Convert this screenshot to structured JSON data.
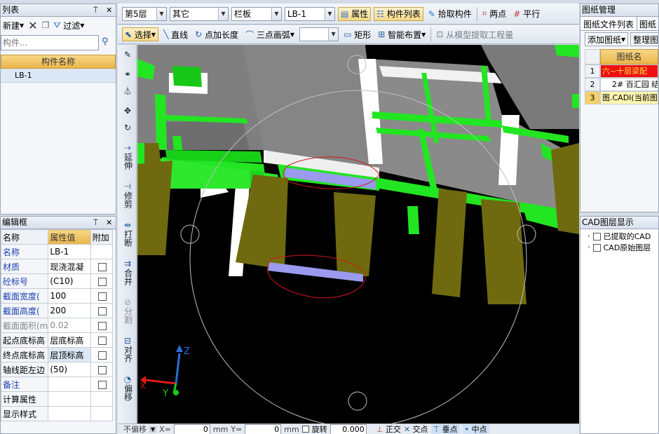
{
  "left_panel": {
    "title": "列表",
    "new_label": "新建",
    "filter_label": "过滤",
    "search_placeholder": "构件...",
    "column_header": "构件名称",
    "rows": [
      {
        "index": "1",
        "name": "LB-1"
      }
    ]
  },
  "prop_panel": {
    "title": "编辑框",
    "headers": {
      "name": "名称",
      "value": "属性值",
      "extra": "附加"
    },
    "rows": [
      {
        "name": "名称",
        "value": "LB-1",
        "checkbox": false,
        "blue": true
      },
      {
        "name": "材质",
        "value": "现浇混凝",
        "checkbox": true,
        "blue": true
      },
      {
        "name": "砼标号",
        "value": "(C10)",
        "checkbox": true,
        "blue": true
      },
      {
        "name": "截面宽度(",
        "value": "100",
        "checkbox": true,
        "blue": true
      },
      {
        "name": "截面高度(",
        "value": "200",
        "checkbox": true,
        "blue": true
      },
      {
        "name": "截面面积(m",
        "value": "0.02",
        "checkbox": true,
        "blue": false,
        "gray": true
      },
      {
        "name": "起点底标高",
        "value": "层底标高",
        "checkbox": true,
        "blue": false
      },
      {
        "name": "终点底标高",
        "value": "层顶标高",
        "checkbox": true,
        "blue": false
      },
      {
        "name": "轴线距左边",
        "value": "(50)",
        "checkbox": true,
        "blue": false
      },
      {
        "name": "备注",
        "value": "",
        "checkbox": true,
        "blue": true
      },
      {
        "name": "计算属性",
        "value": "",
        "checkbox": false,
        "blue": false,
        "expand": true
      },
      {
        "name": "显示样式",
        "value": "",
        "checkbox": false,
        "blue": false,
        "expand": true
      }
    ]
  },
  "toolbar1": {
    "floor": "第5层",
    "category": "其它",
    "type": "栏板",
    "component": "LB-1",
    "properties": "属性",
    "component_list": "构件列表",
    "pick_component": "拾取构件",
    "two_points": "两点",
    "parallel": "平行"
  },
  "toolbar2": {
    "select": "选择",
    "line": "直线",
    "point_length": "点加长度",
    "three_point_arc": "三点画弧",
    "rectangle": "矩形",
    "smart_layout": "智能布置",
    "extract_model": "从模型提取工程量"
  },
  "vertical_tools": [
    {
      "icon": "extend-icon",
      "label": "延伸"
    },
    {
      "icon": "trim-icon",
      "label": "修剪"
    },
    {
      "icon": "break-icon",
      "label": "打断"
    },
    {
      "icon": "merge-icon",
      "label": "合并"
    },
    {
      "icon": "split-icon",
      "label": "分割"
    },
    {
      "icon": "align-icon",
      "label": "对齐"
    },
    {
      "icon": "offset-icon",
      "label": "偏移"
    }
  ],
  "status_bar": {
    "no_offset": "不偏移",
    "x_label": "X=",
    "x_value": "0",
    "unit": "mm",
    "y_label": "Y=",
    "y_value": "0",
    "rotate_label": "旋转",
    "rotate_value": "0.000",
    "ortho": "正交",
    "intersect": "交点",
    "perpendicular": "垂点",
    "midpoint": "中点"
  },
  "drawing_panel": {
    "title": "图纸管理",
    "tab_files": "图纸文件列表",
    "tab_other": "图纸",
    "add_button": "添加图纸",
    "organize_button": "整理图",
    "column_header": "图纸名",
    "rows": [
      {
        "index": "1",
        "text": "六~十层梁配",
        "style": "red"
      },
      {
        "index": "2",
        "text": "2# 百汇园 结",
        "style": "normal"
      },
      {
        "index": "3",
        "text": "图.CADI(当前图",
        "style": "yellow"
      }
    ]
  },
  "cad_layer_panel": {
    "title": "CAD图层显示",
    "items": [
      "已提取的CAD",
      "CAD原始图层"
    ]
  },
  "viewport": {
    "axes": {
      "x": "X",
      "y": "Y",
      "z": "Z"
    }
  },
  "colors": {
    "accent": "#e8a21a",
    "background_3d": "#000000",
    "slab": "#7f7f7f",
    "beam": "#19e619",
    "column": "#6f6a10",
    "selected": "#9a9aef"
  }
}
